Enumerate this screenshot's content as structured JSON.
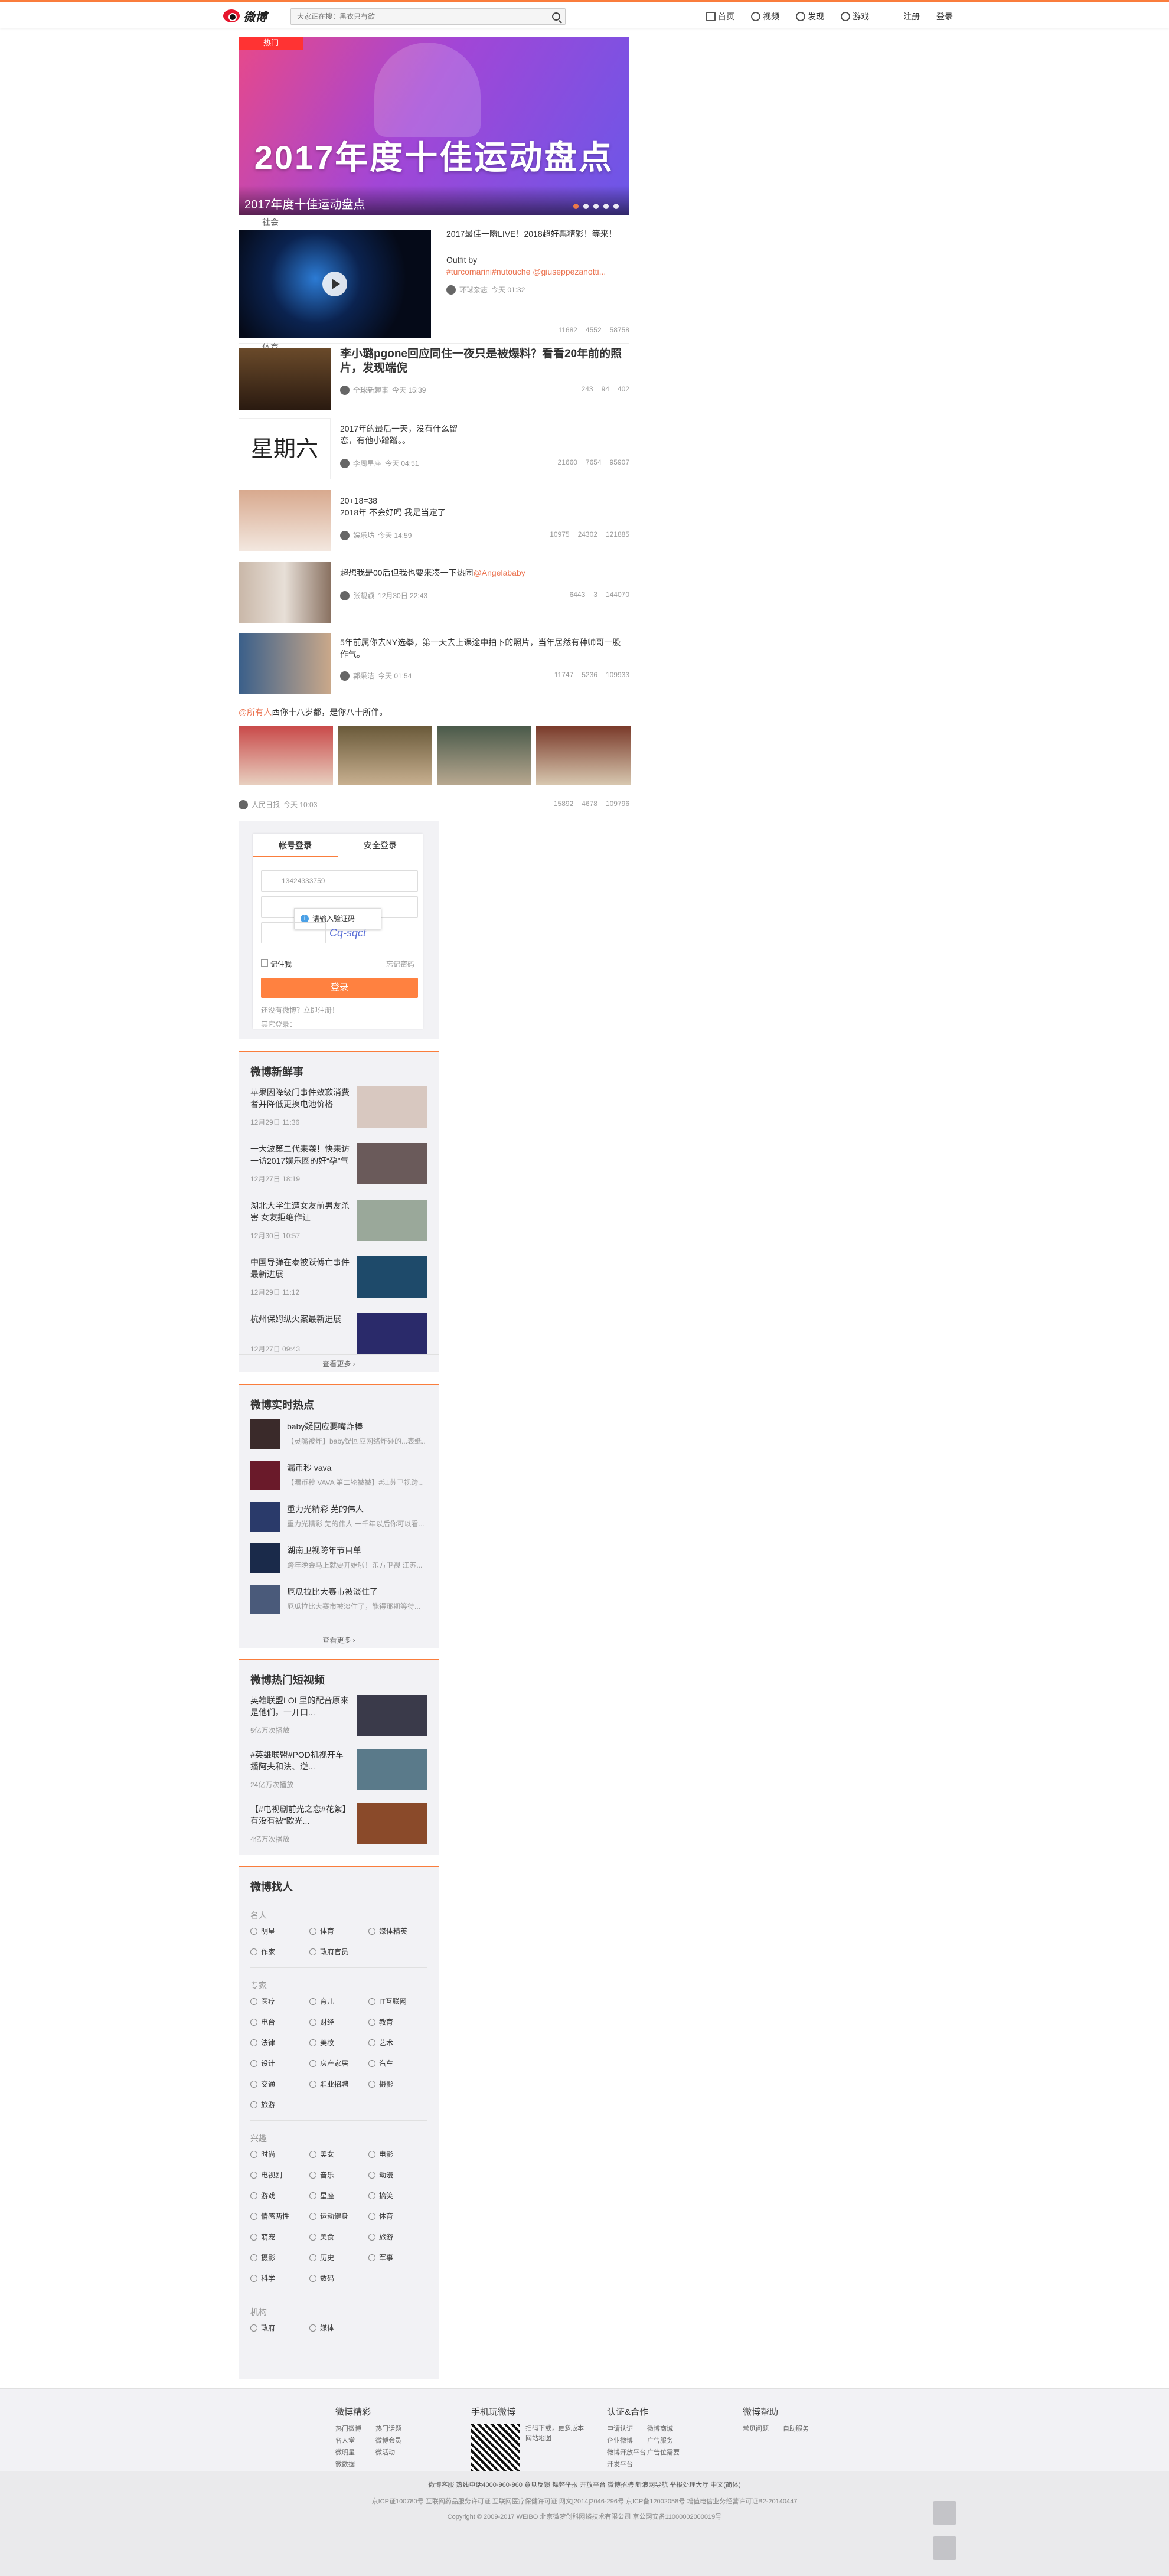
{
  "header": {
    "logo": "微博",
    "search_placeholder": "大家正在搜：黑衣只有欲",
    "nav": [
      "首页",
      "视频",
      "发现",
      "游戏",
      "注册",
      "登录"
    ]
  },
  "banner": {
    "tag": "热门",
    "headline": "2017年度十佳运动盘点",
    "caption": "2017年度十佳运动盘点"
  },
  "feed": [
    {
      "label": "社会",
      "text": "2017最佳一瞬LIVE！2018超好票精彩！等来！",
      "text2": "Outfit by",
      "link": "#turcomarini#nutouche @giuseppezanotti...",
      "author": "环球杂志",
      "time": "今天 01:32",
      "stats": [
        "11682",
        "4552",
        "58758"
      ]
    },
    {
      "label": "体育",
      "title": "李小璐pgone回应同住一夜只是被爆料？看看20年前的照片，发现端倪",
      "author": "全球新趣事",
      "time": "今天 15:39",
      "stats": [
        "243",
        "94",
        "402"
      ]
    },
    {
      "text": "2017年的最后一天，没有什么留恋，有他小蹭蹭。。",
      "author": "李周星座",
      "time": "今天 04:51",
      "stats": [
        "21660",
        "7654",
        "95907"
      ]
    },
    {
      "text": "20+18=38",
      "text2": "2018年 不会好吗 我是当定了",
      "author": "娱乐坊",
      "time": "今天 14:59",
      "stats": [
        "10975",
        "24302",
        "121885"
      ]
    },
    {
      "text": "超想我是00后但我也要来凑一下热闹",
      "link": "@Angelababy",
      "author": "张靓颖",
      "time": "12月30日 22:43",
      "stats": [
        "6443",
        "3",
        "144070"
      ]
    },
    {
      "text": "5年前属你去NY选拳，第一天去上课途中拍下的照片，当年居然有种帅哥一股作气。",
      "author": "郭采洁",
      "time": "今天 01:54",
      "stats": [
        "11747",
        "5236",
        "109933"
      ]
    },
    {
      "link": "@所有人",
      "text": "西你十八岁都，是你八十所伴。",
      "author": "人民日报",
      "time": "今天 10:03",
      "stats": [
        "15892",
        "4678",
        "109796"
      ]
    }
  ],
  "login": {
    "tabs": [
      "帐号登录",
      "安全登录"
    ],
    "user": "13424333759",
    "tip": "请输入验证码",
    "captcha": "Cq-sqct",
    "remember": "记住我",
    "forgot": "忘记密码",
    "button": "登录",
    "register": "还没有微博？立即注册！",
    "other": "其它登录："
  },
  "news": {
    "title": "微博新鲜事",
    "items": [
      {
        "t": "苹果因降级门事件致歉消费者并降低更换电池价格",
        "d": "12月29日 11:36"
      },
      {
        "t": "一大波第二代来袭！快来访一访2017娱乐圈的好“孕”气",
        "d": "12月27日 18:19"
      },
      {
        "t": "湖北大学生遭女友前男友杀害 女友拒绝作证",
        "d": "12月30日 10:57"
      },
      {
        "t": "中国导弹在泰被跃傅亡事件最新进展",
        "d": "12月29日 11:12"
      },
      {
        "t": "杭州保姆纵火案最新进展",
        "d": "12月27日 09:43"
      }
    ],
    "more": "查看更多 ›"
  },
  "hot": {
    "title": "微博实时热点",
    "items": [
      {
        "t": "baby疑回应要嘴炸棒",
        "s": "【灵嘴被炸】baby疑回应网络炸碰的...表纸..."
      },
      {
        "t": "漏币秒 vava",
        "s": "【漏币秒 VAVA 第二轮被被】#江苏卫视跨..."
      },
      {
        "t": "重力光精彩 芜的伟人",
        "s": "重力光精彩 芜的伟人 一千年以后你可以看..."
      },
      {
        "t": "湖南卫视跨年节目单",
        "s": "跨年晚会马上就要开始啦！东方卫视 江苏..."
      },
      {
        "t": "厄瓜拉比大赛市被淡住了",
        "s": "厄瓜拉比大赛市被淡住了，能得那期等待..."
      }
    ],
    "more": "查看更多 ›"
  },
  "videos": {
    "title": "微博热门短视频",
    "items": [
      {
        "t": "英雄联盟LOL里的配音原来是他们，一开口...",
        "d": "5亿万次播放"
      },
      {
        "t": "#英雄联盟#POD机视开车 播阿夫和法、逆...",
        "d": "24亿万次播放"
      },
      {
        "t": "【#电视剧前光之恋#花絮】有没有被“欧光...",
        "d": "4亿万次播放"
      }
    ]
  },
  "finder": {
    "title": "微博找人",
    "groups": [
      {
        "name": "名人",
        "items": [
          "明星",
          "体育",
          "媒体精英",
          "作家",
          "政府官员"
        ]
      },
      {
        "name": "专家",
        "items": [
          "医疗",
          "育儿",
          "IT互联网",
          "电台",
          "财经",
          "教育",
          "法律",
          "美妆",
          "艺术",
          "设计",
          "房产家居",
          "汽车",
          "交通",
          "职业招聘",
          "摄影",
          "旅游"
        ]
      },
      {
        "name": "兴趣",
        "items": [
          "时尚",
          "美女",
          "电影",
          "电视剧",
          "音乐",
          "动漫",
          "游戏",
          "星座",
          "搞笑",
          "情感两性",
          "运动健身",
          "体育",
          "萌宠",
          "美食",
          "旅游",
          "摄影",
          "历史",
          "军事",
          "科学",
          "数码"
        ]
      },
      {
        "name": "机构",
        "items": [
          "政府",
          "媒体"
        ]
      }
    ]
  },
  "footer": {
    "cols": [
      {
        "title": "微博精彩",
        "links": [
          "热门微博",
          "热门话题",
          "名人堂",
          "微博会员",
          "微明星",
          "微活动",
          "微数据"
        ]
      },
      {
        "title": "手机玩微博",
        "links": [
          "扫码下载，更多版本",
          "网站地图"
        ]
      },
      {
        "title": "认证&合作",
        "links": [
          "申请认证",
          "微博商城",
          "企业微博",
          "广告服务",
          "微博开放平台",
          "广告位需要",
          "开发平台"
        ]
      },
      {
        "title": "微博帮助",
        "links": [
          "常见问题",
          "自助服务"
        ]
      }
    ],
    "line1": "微博客服 热线电话4000-960-960 意见反馈 舞弊举报 开放平台 微博招聘 新浪网导航 举报处理大厅  中文(简体)",
    "line2": "京ICP证100780号 互联网药品服务许可证 互联网医疗保健许可证 网文[2014]2046-296号 京ICP备12002058号 增值电信业务经营许可证B2-20140447",
    "line3": "Copyright © 2009-2017 WEIBO 北京微梦创科网络技术有限公司  京公网安备11000002000019号"
  }
}
